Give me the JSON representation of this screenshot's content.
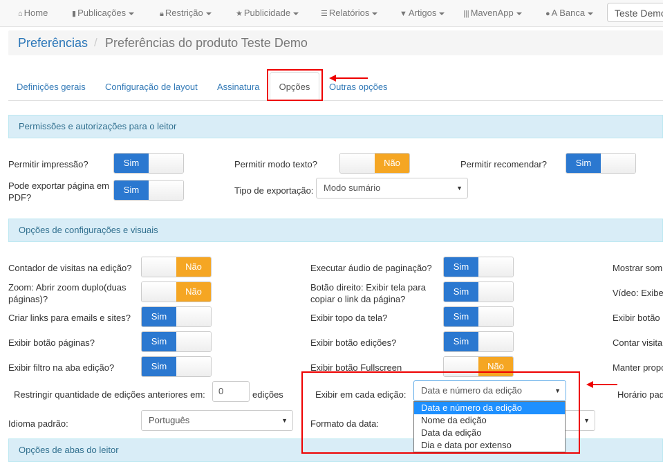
{
  "navbar": {
    "items": [
      {
        "label": "Home",
        "icon": "home-icon",
        "dropdown": false
      },
      {
        "label": "Publicações",
        "icon": "book-icon",
        "dropdown": true
      },
      {
        "label": "Restrição",
        "icon": "lock-icon",
        "dropdown": true
      },
      {
        "label": "Publicidade",
        "icon": "star-icon",
        "dropdown": true
      },
      {
        "label": "Relatórios",
        "icon": "list-icon",
        "dropdown": true
      },
      {
        "label": "Artigos",
        "icon": "bookmark-icon",
        "dropdown": true
      },
      {
        "label": "MavenApp",
        "icon": "barcode-icon",
        "dropdown": true
      },
      {
        "label": "A Banca",
        "icon": "globe-icon",
        "dropdown": true
      }
    ],
    "product_select": "Teste Demo"
  },
  "breadcrumb": {
    "home": "Preferências",
    "separator": "/",
    "current": "Preferências do produto Teste Demo"
  },
  "tabs": [
    {
      "label": "Definições gerais"
    },
    {
      "label": "Configuração de layout"
    },
    {
      "label": "Assinatura"
    },
    {
      "label": "Opções"
    },
    {
      "label": "Outras opções"
    }
  ],
  "sections": {
    "permissions": "Permissões e autorizações para o leitor",
    "config": "Opções de configurações e visuais",
    "tabs": "Opções de abas do leitor"
  },
  "permissions": {
    "print_label": "Permitir impressão?",
    "text_mode_label": "Permitir modo texto?",
    "recommend_label": "Permitir recomendar?",
    "export_pdf_label": "Pode exportar página em PDF?",
    "export_type_label": "Tipo de exportação:",
    "export_type_value": "Modo sumário"
  },
  "toggle": {
    "sim": "Sim",
    "nao": "Não"
  },
  "config": {
    "col1": [
      "Contador de visitas na edição?",
      "Zoom: Abrir zoom duplo(duas páginas)?",
      "Criar links para emails e sites?",
      "Exibir botão páginas?",
      "Exibir filtro na aba edição?"
    ],
    "col2": [
      "Executar áudio de paginação?",
      "Botão direito: Exibir tela para copiar o link da página?",
      "Exibir topo da tela?",
      "Exibir botão edições?",
      "Exibir botão Fullscreen"
    ],
    "col3": [
      "Mostrar som",
      "Vídeo: Exibe",
      "Exibir botão",
      "Contar visita",
      "Manter propo"
    ],
    "restrict_label": "Restringir quantidade de edições anteriores em:",
    "restrict_value": "0",
    "restrict_suffix": "edições",
    "show_each_label": "Exibir em cada edição:",
    "show_each_value": "Data e número da edição",
    "show_each_options": [
      "Data e número da edição",
      "Nome da edição",
      "Data da edição",
      "Dia e data por extenso"
    ],
    "time_label": "Horário pad",
    "language_label": "Idioma padrão:",
    "language_value": "Português",
    "date_format_label": "Formato da data:"
  },
  "colors": {
    "accent": "#2b78d0",
    "warning": "#f5a623",
    "annotation": "#e00000",
    "section_bg": "#d9edf7"
  }
}
